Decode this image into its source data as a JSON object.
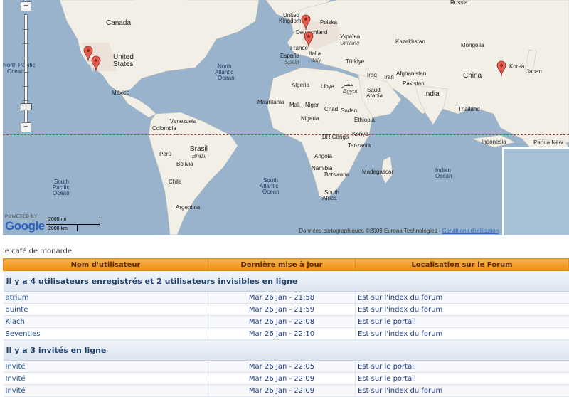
{
  "map": {
    "zoom_in": "+",
    "zoom_out": "−",
    "powered_by": "POWERED BY",
    "google": "Google",
    "scale_mi": "2000 mi",
    "scale_km": "2000 km",
    "credits": "Données cartographiques ©2009 Europa Technologies -",
    "terms_link": "Conditions d'utilisation",
    "labels": {
      "canada": "Canada",
      "united_states_1": "United",
      "united_states_2": "States",
      "mexico": "México",
      "north_pacific_1": "North Pacific",
      "north_pacific_2": "Ocean",
      "north_atlantic_1": "North",
      "north_atlantic_2": "Atlantic",
      "north_atlantic_3": "Ocean",
      "venezuela": "Venezuela",
      "colombia": "Colombia",
      "peru": "Perú",
      "brasil": "Brasil",
      "brazil": "Brazil",
      "bolivia": "Bolivia",
      "chile": "Chile",
      "argentina": "Argentina",
      "south_pacific_1": "South",
      "south_pacific_2": "Pacific",
      "south_pacific_3": "Ocean",
      "south_atlantic_1": "South",
      "south_atlantic_2": "Atlantic",
      "south_atlantic_3": "Ocean",
      "united_kingdom_1": "United",
      "united_kingdom_2": "Kingdom",
      "deutschland": "Deutschland",
      "polska": "Polska",
      "ukraina": "Україна",
      "ukraine": "Ukraine",
      "france": "France",
      "espana": "España",
      "spain": "Spain",
      "italia": "Italia",
      "italy": "Italy",
      "turkiye": "Türkiye",
      "kazakhstan": "Kazakhstan",
      "mongolia": "Mongolia",
      "iraq": "Iraq",
      "iran": "Iran",
      "afghanistan": "Afghanistan",
      "pakistan": "Pakistan",
      "india": "India",
      "china": "China",
      "korea": "Korea",
      "japan": "Japan",
      "thailand": "Thailand",
      "indonesia": "Indonesia",
      "papua": "Papua New",
      "algeria": "Algeria",
      "libya": "Libya",
      "misr": "مصر",
      "egypt": "Egypt",
      "saudi_1": "Saudi",
      "saudi_2": "Arabia",
      "mauritania": "Mauritania",
      "mali": "Mali",
      "niger": "Niger",
      "chad": "Chad",
      "sudan": "Sudan",
      "nigeria": "Nigeria",
      "ethiopia": "Ethiopia",
      "dr_congo": "DR Congo",
      "kenya": "Kenya",
      "tanzania": "Tanzania",
      "angola": "Angola",
      "namibia": "Namibia",
      "botswana": "Botswana",
      "madagascar": "Madagascar",
      "south_africa": "South",
      "south_africa_2": "Africa",
      "indian_ocean_1": "Indian",
      "indian_ocean_2": "Ocean",
      "russia": "Russia"
    }
  },
  "forum": {
    "site_name": "le café de monarde",
    "headers": {
      "user": "Nom d'utilisateur",
      "last_update": "Dernière mise à jour",
      "location": "Localisation sur le Forum"
    },
    "registered_title": "Il y a 4 utilisateurs enregistrés et 2 utilisateurs invisibles en ligne",
    "registered": [
      {
        "name": "atrium",
        "time": "Mar 26 Jan - 21:58",
        "location": "Est sur l'index du forum"
      },
      {
        "name": "quinte",
        "time": "Mar 26 Jan - 21:59",
        "location": "Est sur l'index du forum"
      },
      {
        "name": "Klach",
        "time": "Mar 26 Jan - 22:08",
        "location": "Est sur le portail"
      },
      {
        "name": "Seventies",
        "time": "Mar 26 Jan - 22:10",
        "location": "Est sur l'index du forum"
      }
    ],
    "guests_title": "Il y a 3 invités en ligne",
    "guests": [
      {
        "name": "Invité",
        "time": "Mar 26 Jan - 22:05",
        "location": "Est sur le portail"
      },
      {
        "name": "Invité",
        "time": "Mar 26 Jan - 22:09",
        "location": "Est sur le portail"
      },
      {
        "name": "Invité",
        "time": "Mar 26 Jan - 22:09",
        "location": "Est sur l'index du forum"
      }
    ]
  },
  "colors": {
    "ocean": "#99b3cc",
    "land": "#f2efe6",
    "header_orange": "#f08c10",
    "link_blue": "#233e8b",
    "marker_red": "#e65c4f"
  }
}
